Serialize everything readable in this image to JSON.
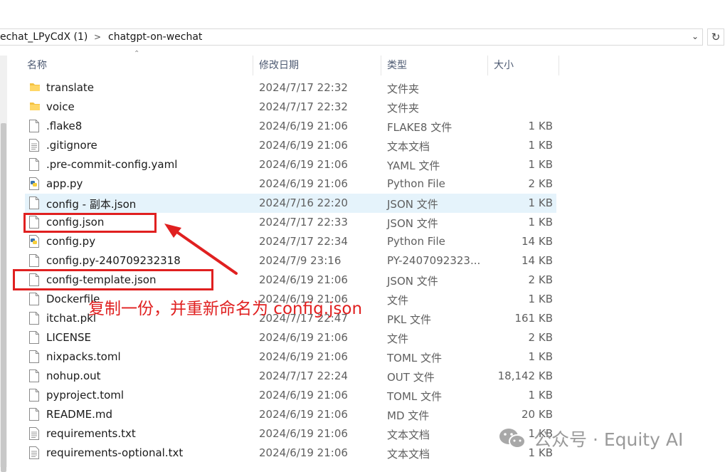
{
  "address_bar": {
    "crumbs": [
      "echat_LPyCdX (1)",
      "chatgpt-on-wechat"
    ],
    "separator": ">"
  },
  "columns": {
    "name": "名称",
    "date": "修改日期",
    "type": "类型",
    "size": "大小"
  },
  "files": [
    {
      "name": "translate",
      "date": "2024/7/17 22:32",
      "type": "文件夹",
      "size": "",
      "icon": "folder-icon"
    },
    {
      "name": "voice",
      "date": "2024/7/17 22:32",
      "type": "文件夹",
      "size": "",
      "icon": "folder-icon"
    },
    {
      "name": ".flake8",
      "date": "2024/6/19 21:06",
      "type": "FLAKE8 文件",
      "size": "1 KB",
      "icon": "file-icon"
    },
    {
      "name": ".gitignore",
      "date": "2024/6/19 21:06",
      "type": "文本文档",
      "size": "1 KB",
      "icon": "text-file-icon"
    },
    {
      "name": ".pre-commit-config.yaml",
      "date": "2024/6/19 21:06",
      "type": "YAML 文件",
      "size": "1 KB",
      "icon": "file-icon"
    },
    {
      "name": "app.py",
      "date": "2024/6/19 21:06",
      "type": "Python File",
      "size": "2 KB",
      "icon": "python-file-icon"
    },
    {
      "name": "config - 副本.json",
      "date": "2024/7/16 22:20",
      "type": "JSON 文件",
      "size": "1 KB",
      "icon": "file-icon",
      "selected": true
    },
    {
      "name": "config.json",
      "date": "2024/7/17 22:33",
      "type": "JSON 文件",
      "size": "1 KB",
      "icon": "file-icon"
    },
    {
      "name": "config.py",
      "date": "2024/7/17 22:34",
      "type": "Python File",
      "size": "14 KB",
      "icon": "python-file-icon"
    },
    {
      "name": "config.py-240709232318",
      "date": "2024/7/9 23:16",
      "type": "PY-2407092323...",
      "size": "14 KB",
      "icon": "file-icon"
    },
    {
      "name": "config-template.json",
      "date": "2024/6/19 21:06",
      "type": "JSON 文件",
      "size": "2 KB",
      "icon": "file-icon"
    },
    {
      "name": "Dockerfile",
      "date": "2024/6/19 21:06",
      "type": "文件",
      "size": "1 KB",
      "icon": "file-icon"
    },
    {
      "name": "itchat.pkl",
      "date": "2024/7/17 22:47",
      "type": "PKL 文件",
      "size": "161 KB",
      "icon": "file-icon"
    },
    {
      "name": "LICENSE",
      "date": "2024/6/19 21:06",
      "type": "文件",
      "size": "2 KB",
      "icon": "file-icon"
    },
    {
      "name": "nixpacks.toml",
      "date": "2024/6/19 21:06",
      "type": "TOML 文件",
      "size": "1 KB",
      "icon": "file-icon"
    },
    {
      "name": "nohup.out",
      "date": "2024/7/17 22:24",
      "type": "OUT 文件",
      "size": "18,142 KB",
      "icon": "file-icon"
    },
    {
      "name": "pyproject.toml",
      "date": "2024/6/19 21:06",
      "type": "TOML 文件",
      "size": "1 KB",
      "icon": "file-icon"
    },
    {
      "name": "README.md",
      "date": "2024/6/19 21:06",
      "type": "MD 文件",
      "size": "20 KB",
      "icon": "file-icon"
    },
    {
      "name": "requirements.txt",
      "date": "2024/6/19 21:06",
      "type": "文本文档",
      "size": "1 KB",
      "icon": "text-file-icon"
    },
    {
      "name": "requirements-optional.txt",
      "date": "2024/6/19 21:06",
      "type": "文本文档",
      "size": "1 KB",
      "icon": "text-file-icon"
    }
  ],
  "annotation": {
    "text": "复制一份，并重新命名为 config.json",
    "color": "#e02020"
  },
  "watermark": {
    "text": "公众号 · Equity AI",
    "icon": "wechat-icon"
  }
}
